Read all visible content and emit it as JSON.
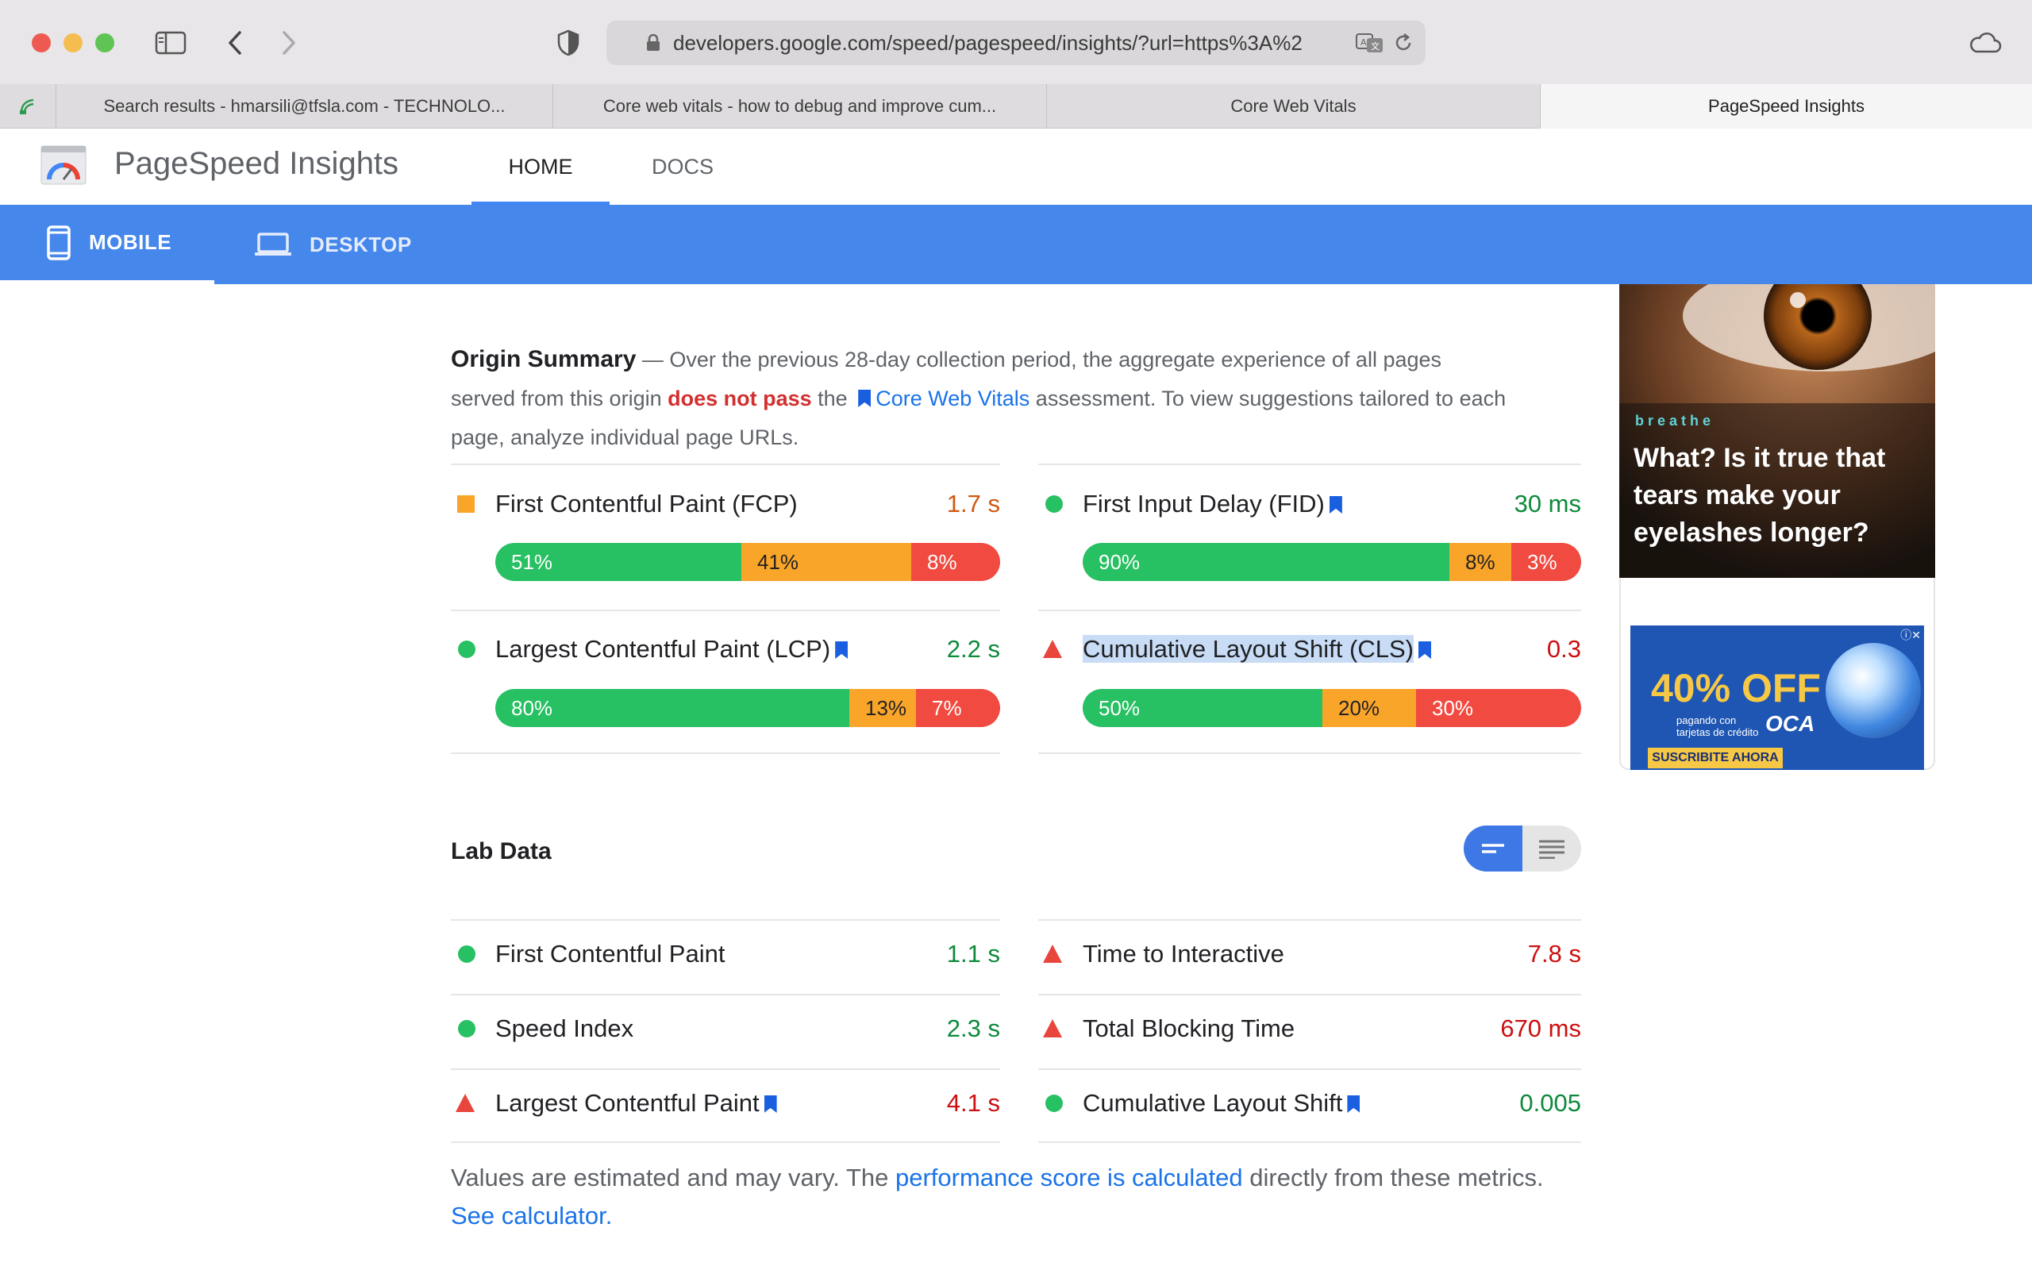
{
  "browser": {
    "url": "developers.google.com/speed/pagespeed/insights/?url=https%3A%2",
    "tabs": [
      {
        "label": "Search results - hmarsili@tfsla.com - TECHNOLO..."
      },
      {
        "label": "Core web vitals - how to debug and improve cum..."
      },
      {
        "label": "Core Web Vitals"
      },
      {
        "label": "PageSpeed Insights"
      }
    ]
  },
  "header": {
    "title": "PageSpeed Insights",
    "nav": {
      "home": "HOME",
      "docs": "DOCS"
    },
    "devices": {
      "mobile": "MOBILE",
      "desktop": "DESKTOP"
    }
  },
  "origin": {
    "heading": "Origin Summary",
    "text_1": " — Over the previous 28-day collection period, the aggregate experience of all pages served from this origin ",
    "fail_text": "does not pass",
    "text_2": " the ",
    "cwv_link": "Core Web Vitals",
    "text_3": " assessment. To view suggestions tailored to each page, analyze individual page URLs.",
    "metrics": {
      "fcp": {
        "name": "First Contentful Paint (FCP)",
        "value": "1.7 s",
        "status": "average",
        "dist": [
          {
            "label": "51%",
            "fraction": 0.51
          },
          {
            "label": "41%",
            "fraction": 0.41
          },
          {
            "label": "8%",
            "fraction": 0.08
          }
        ]
      },
      "fid": {
        "name": "First Input Delay (FID)",
        "value": "30 ms",
        "status": "good",
        "dist": [
          {
            "label": "90%",
            "fraction": 0.9
          },
          {
            "label": "8%",
            "fraction": 0.08
          },
          {
            "label": "3%",
            "fraction": 0.03
          }
        ]
      },
      "lcp": {
        "name": "Largest Contentful Paint (LCP)",
        "value": "2.2 s",
        "status": "good",
        "dist": [
          {
            "label": "80%",
            "fraction": 0.8
          },
          {
            "label": "13%",
            "fraction": 0.13
          },
          {
            "label": "7%",
            "fraction": 0.07
          }
        ]
      },
      "cls": {
        "name": "Cumulative Layout Shift (CLS)",
        "value": "0.3",
        "status": "poor",
        "dist": [
          {
            "label": "50%",
            "fraction": 0.5
          },
          {
            "label": "20%",
            "fraction": 0.2
          },
          {
            "label": "30%",
            "fraction": 0.3
          }
        ]
      }
    }
  },
  "lab": {
    "title": "Lab Data",
    "metrics": {
      "fcp": {
        "name": "First Contentful Paint",
        "value": "1.1 s",
        "status": "good"
      },
      "si": {
        "name": "Speed Index",
        "value": "2.3 s",
        "status": "good"
      },
      "lcp": {
        "name": "Largest Contentful Paint",
        "value": "4.1 s",
        "status": "poor"
      },
      "tti": {
        "name": "Time to Interactive",
        "value": "7.8 s",
        "status": "poor"
      },
      "tbt": {
        "name": "Total Blocking Time",
        "value": "670 ms",
        "status": "poor"
      },
      "cls": {
        "name": "Cumulative Layout Shift",
        "value": "0.005",
        "status": "good"
      }
    },
    "note_1": "Values are estimated and may vary. The ",
    "note_link_1": "performance score is calculated",
    "note_2": " directly from these metrics. ",
    "note_link_2": "See calculator."
  },
  "ads": {
    "ad1": {
      "brand": "breathe",
      "headline": "What? Is it true that tears make your eyelashes longer?"
    },
    "ad2": {
      "offer": "40% OFF",
      "small_text": "pagando con tarjetas de crédito",
      "brand": "OCA",
      "cta": "SUSCRIBITE AHORA"
    }
  },
  "colors": {
    "accent": "#4687ec",
    "good": "#27c062",
    "average": "#f9a52a",
    "poor": "#f04a41"
  }
}
